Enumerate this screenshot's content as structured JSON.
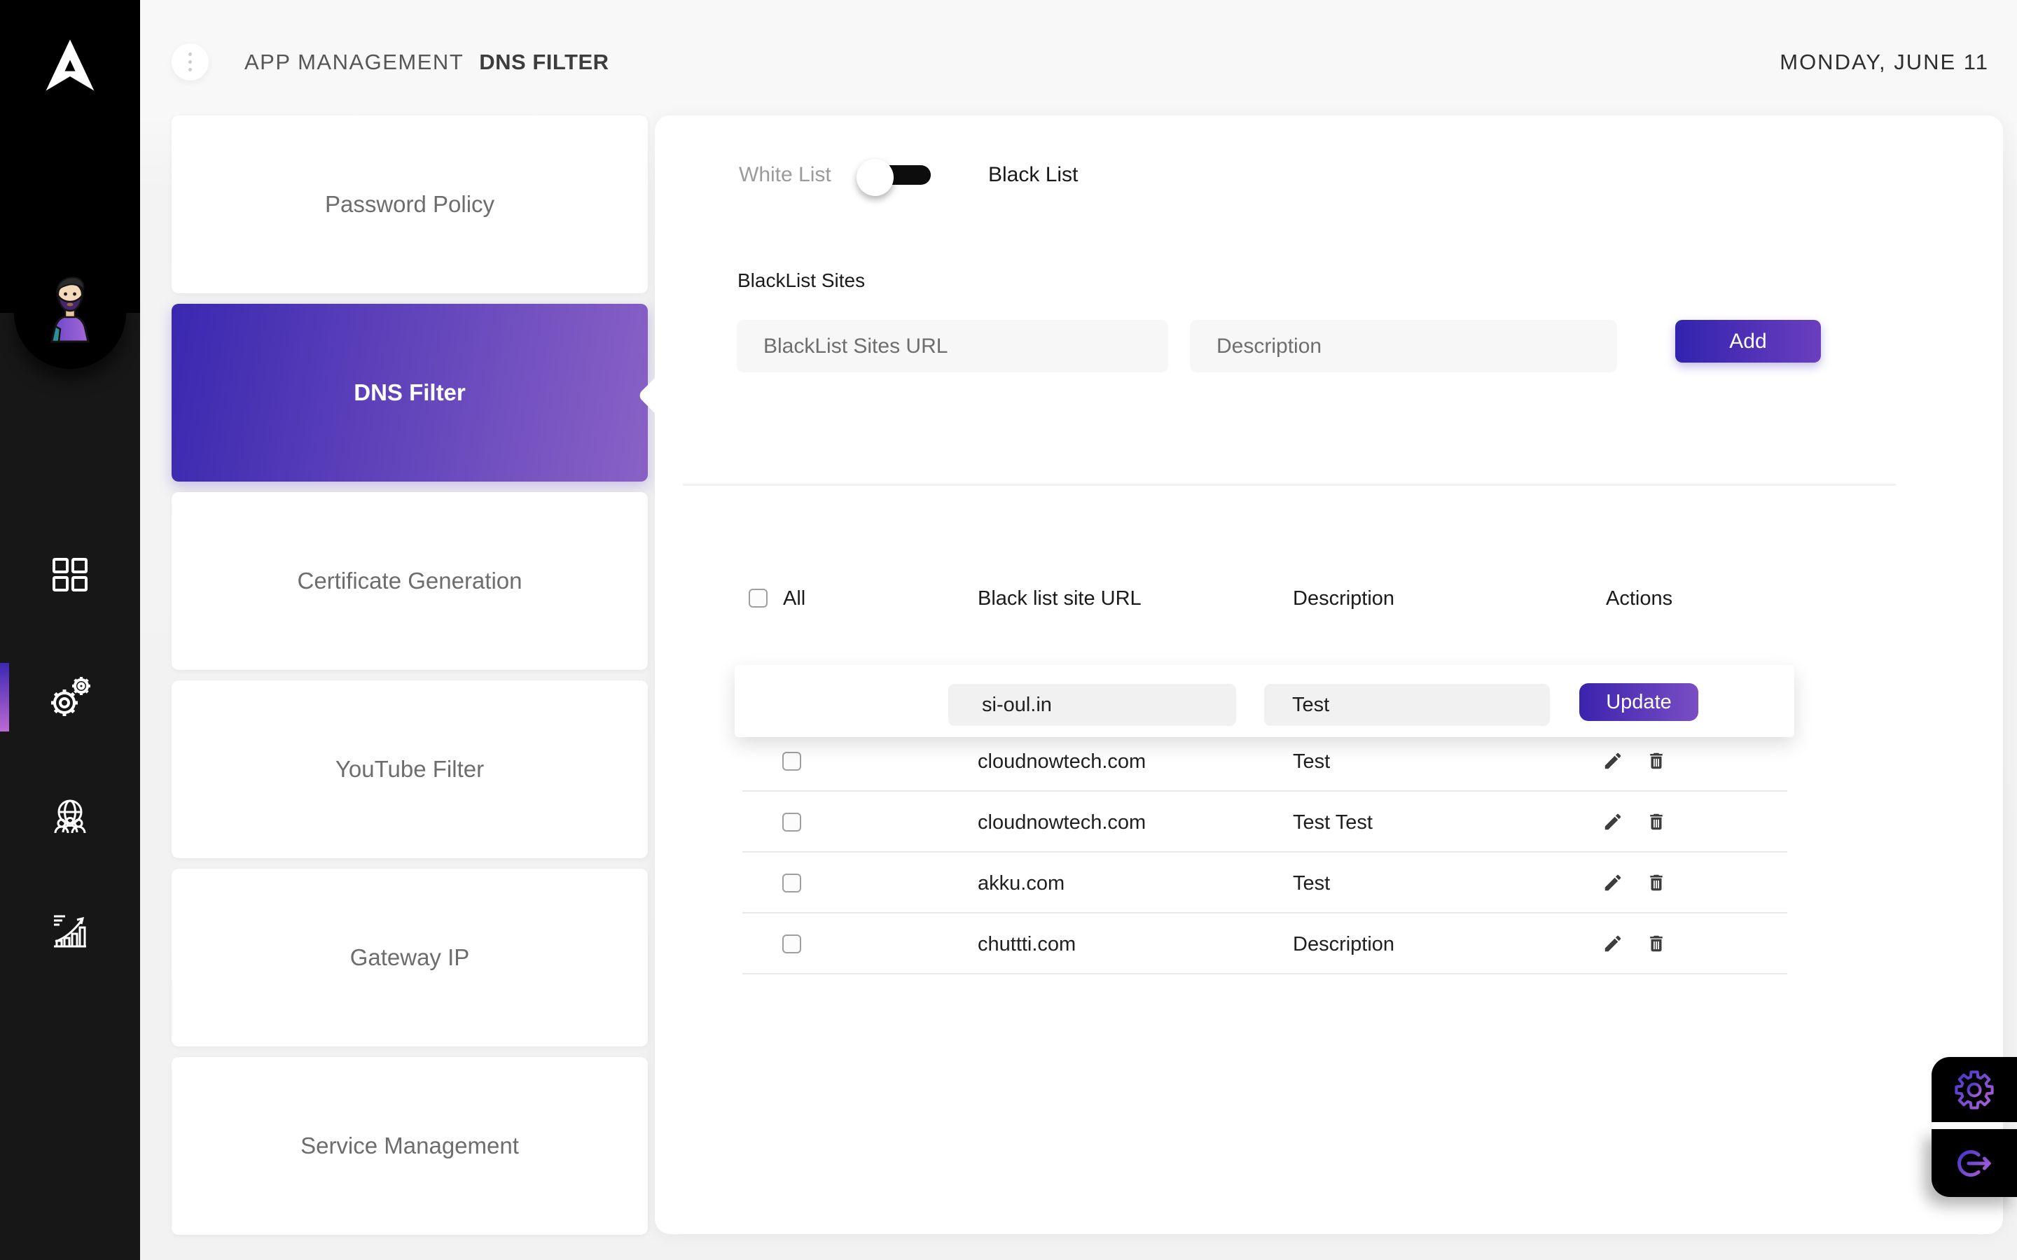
{
  "header": {
    "title_prefix": "APP MANAGEMENT",
    "title": "DNS FILTER",
    "date": "MONDAY, JUNE 11"
  },
  "sidebar": {
    "nav_icons": [
      {
        "name": "apps-grid",
        "active": false
      },
      {
        "name": "settings-gears",
        "active": true
      },
      {
        "name": "global-users",
        "active": false
      },
      {
        "name": "reports-chart",
        "active": false
      }
    ]
  },
  "menu_cards": {
    "items": [
      {
        "label": "Password Policy",
        "active": false
      },
      {
        "label": "DNS Filter",
        "active": true
      },
      {
        "label": "Certificate Generation",
        "active": false
      },
      {
        "label": "YouTube Filter",
        "active": false
      },
      {
        "label": "Gateway IP",
        "active": false
      },
      {
        "label": "Service Management",
        "active": false
      }
    ]
  },
  "filter_panel": {
    "toggle": {
      "left_label": "White List",
      "right_label": "Black List",
      "selected": "Black List"
    },
    "form": {
      "section_label": "BlackList Sites",
      "url_placeholder": "BlackList Sites URL",
      "description_placeholder": "Description",
      "add_label": "Add"
    },
    "table": {
      "select_all_label": "All",
      "columns": {
        "url": "Black list site URL",
        "description": "Description",
        "actions": "Actions"
      },
      "edit_row": {
        "url_value": "si-oul.in",
        "description_value": "Test",
        "update_label": "Update"
      },
      "rows": [
        {
          "url": "cloudnowtech.com",
          "description": "Test"
        },
        {
          "url": "cloudnowtech.com",
          "description": "Test Test"
        },
        {
          "url": "akku.com",
          "description": "Test"
        },
        {
          "url": "chuttti.com",
          "description": "Description"
        }
      ]
    }
  },
  "colors": {
    "accent_start": "#3223ae",
    "accent_end": "#8c65c7",
    "sidebar_lower": "#171717",
    "sidebar_top": "#000000",
    "indicator_top": "#3b28b1",
    "indicator_bottom": "#be68d5"
  }
}
